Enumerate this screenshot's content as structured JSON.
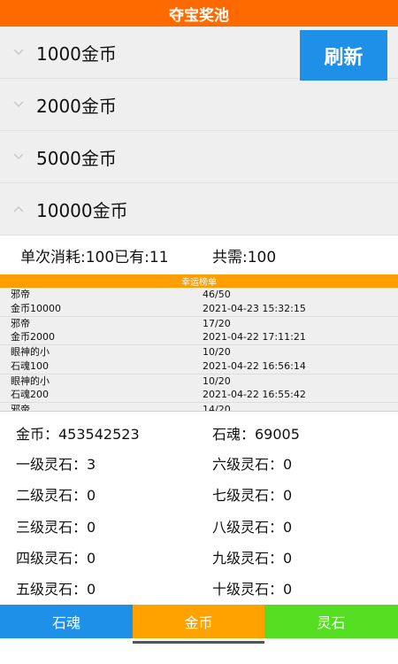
{
  "header": {
    "title": "夺宝奖池"
  },
  "refresh_label": "刷新",
  "tiers": [
    {
      "label": "1000金币",
      "expanded": false
    },
    {
      "label": "2000金币",
      "expanded": false
    },
    {
      "label": "5000金币",
      "expanded": false
    },
    {
      "label": "10000金币",
      "expanded": true
    }
  ],
  "summary": {
    "cost_text": "单次消耗:100已有:11",
    "total_text": "共需:100"
  },
  "ranking": {
    "title": "幸运榜单",
    "entries": [
      {
        "name": "邪帝",
        "progress": "46/50",
        "prize": "金币10000",
        "time": "2021-04-23 15:32:15"
      },
      {
        "name": "邪帝",
        "progress": "17/20",
        "prize": "金币2000",
        "time": "2021-04-22 17:11:21"
      },
      {
        "name": "眼神的小",
        "progress": "10/20",
        "prize": "石魂100",
        "time": "2021-04-22 16:56:14"
      },
      {
        "name": "眼神的小",
        "progress": "10/20",
        "prize": "石魂200",
        "time": "2021-04-22 16:55:42"
      },
      {
        "name": "邪帝",
        "progress": "14/20",
        "prize": "",
        "time": ""
      }
    ]
  },
  "wallet": {
    "gold": "金币：453542523",
    "stone_soul": "石魂：69005",
    "stones": [
      "一级灵石：3",
      "六级灵石：0",
      "二级灵石：0",
      "七级灵石：0",
      "三级灵石：0",
      "八级灵石：0",
      "四级灵石：0",
      "九级灵石：0",
      "五级灵石：0",
      "十级灵石：0"
    ]
  },
  "tabs": {
    "stone_soul": "石魂",
    "gold": "金币",
    "spirit_stone": "灵石",
    "active": "gold"
  },
  "colors": {
    "header": "#ff6a00",
    "refresh": "#1e90e8",
    "ranking_header": "#ff9e00",
    "tab_stone_soul": "#1e90e8",
    "tab_gold": "#ffa200",
    "tab_spirit_stone": "#55dd22"
  }
}
